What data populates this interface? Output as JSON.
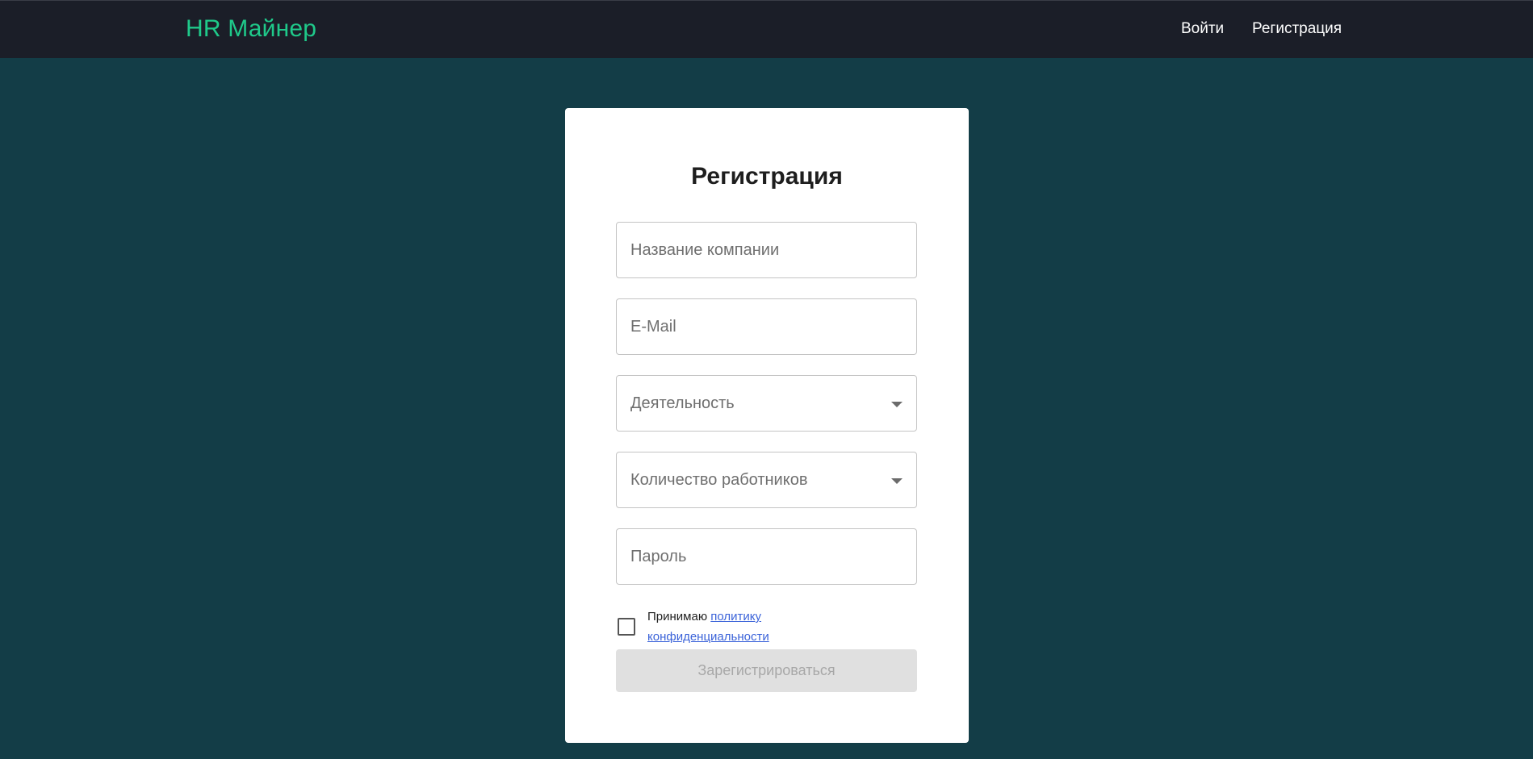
{
  "header": {
    "logo": "HR Майнер",
    "nav": {
      "login": "Войти",
      "register": "Регистрация"
    }
  },
  "form": {
    "title": "Регистрация",
    "company_name": {
      "placeholder": "Название компании",
      "value": ""
    },
    "email": {
      "placeholder": "E-Mail",
      "value": ""
    },
    "activity": {
      "placeholder": "Деятельность",
      "value": ""
    },
    "employees": {
      "placeholder": "Количество работников",
      "value": ""
    },
    "password": {
      "placeholder": "Пароль",
      "value": ""
    },
    "consent": {
      "prefix": "Принимаю",
      "link_part1": "политику",
      "link_part2": "конфиденциальности",
      "checked": false
    },
    "submit_label": "Зарегистрироваться",
    "submit_disabled": true
  },
  "colors": {
    "background": "#133d47",
    "topbar": "#1b1e28",
    "logo": "#1fc98a",
    "link": "#3b63d9",
    "button_disabled": "#e0e0e0"
  },
  "icons": {
    "select_caret": "chevron-down-icon",
    "checkbox": "checkbox-unchecked-icon"
  }
}
